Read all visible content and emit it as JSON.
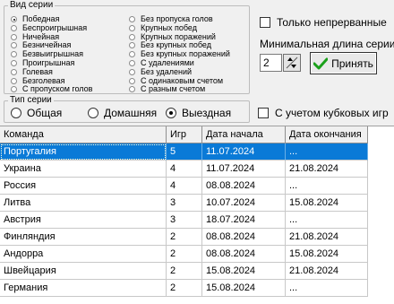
{
  "series_type_group": {
    "legend": "Вид серии",
    "left_column": [
      {
        "label": "Победная",
        "selected": true
      },
      {
        "label": "Беспроигрышная",
        "selected": false
      },
      {
        "label": "Ничейная",
        "selected": false
      },
      {
        "label": "Безничейная",
        "selected": false
      },
      {
        "label": "Безвыигрышная",
        "selected": false
      },
      {
        "label": "Проигрышная",
        "selected": false
      },
      {
        "label": "Голевая",
        "selected": false
      },
      {
        "label": "Безголевая",
        "selected": false
      },
      {
        "label": "С пропуском голов",
        "selected": false
      }
    ],
    "right_column": [
      {
        "label": "Без пропуска голов",
        "selected": false
      },
      {
        "label": "Крупных побед",
        "selected": false
      },
      {
        "label": "Крупных поражений",
        "selected": false
      },
      {
        "label": "Без крупных побед",
        "selected": false
      },
      {
        "label": "Без крупных поражений",
        "selected": false
      },
      {
        "label": "С удалениями",
        "selected": false
      },
      {
        "label": "Без удалений",
        "selected": false
      },
      {
        "label": "С одинаковым счетом",
        "selected": false
      },
      {
        "label": "С разным счетом",
        "selected": false
      }
    ]
  },
  "only_continuous": {
    "label": "Только непрерванные",
    "checked": false
  },
  "min_length": {
    "label": "Минимальная длина серии",
    "value": "2"
  },
  "apply_button": {
    "label": "Принять"
  },
  "series_kind_group": {
    "legend": "Тип серии",
    "options": [
      {
        "label": "Общая",
        "selected": false
      },
      {
        "label": "Домашняя",
        "selected": false
      },
      {
        "label": "Выездная",
        "selected": true
      }
    ]
  },
  "cup_games": {
    "label": "С учетом кубковых игр",
    "checked": false
  },
  "table": {
    "columns": [
      "Команда",
      "Игр",
      "Дата начала",
      "Дата окончания"
    ],
    "rows": [
      {
        "team": "Португалия",
        "games": "5",
        "start": "11.07.2024",
        "end": "...",
        "selected": true
      },
      {
        "team": "Украина",
        "games": "4",
        "start": "11.07.2024",
        "end": "21.08.2024",
        "selected": false
      },
      {
        "team": "Россия",
        "games": "4",
        "start": "08.08.2024",
        "end": "...",
        "selected": false
      },
      {
        "team": "Литва",
        "games": "3",
        "start": "10.07.2024",
        "end": "15.08.2024",
        "selected": false
      },
      {
        "team": "Австрия",
        "games": "3",
        "start": "18.07.2024",
        "end": "...",
        "selected": false
      },
      {
        "team": "Финляндия",
        "games": "2",
        "start": "08.08.2024",
        "end": "21.08.2024",
        "selected": false
      },
      {
        "team": "Андорра",
        "games": "2",
        "start": "08.08.2024",
        "end": "15.08.2024",
        "selected": false
      },
      {
        "team": "Швейцария",
        "games": "2",
        "start": "15.08.2024",
        "end": "21.08.2024",
        "selected": false
      },
      {
        "team": "Германия",
        "games": "2",
        "start": "15.08.2024",
        "end": "...",
        "selected": false
      }
    ]
  },
  "colors": {
    "selection": "#0a7ad7",
    "apply_check": "#1aa01a"
  }
}
